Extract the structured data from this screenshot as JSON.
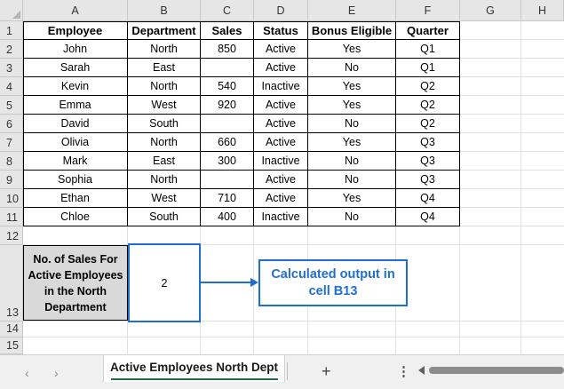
{
  "columns": [
    "A",
    "B",
    "C",
    "D",
    "E",
    "F",
    "G",
    "H"
  ],
  "rows": [
    "1",
    "2",
    "3",
    "4",
    "5",
    "6",
    "7",
    "8",
    "9",
    "10",
    "11",
    "12",
    "13",
    "14",
    "15"
  ],
  "table": {
    "headers": [
      "Employee",
      "Department",
      "Sales",
      "Status",
      "Bonus Eligible",
      "Quarter"
    ],
    "rows": [
      [
        "John",
        "North",
        "850",
        "Active",
        "Yes",
        "Q1"
      ],
      [
        "Sarah",
        "East",
        "",
        "Active",
        "No",
        "Q1"
      ],
      [
        "Kevin",
        "North",
        "540",
        "Inactive",
        "Yes",
        "Q2"
      ],
      [
        "Emma",
        "West",
        "920",
        "Active",
        "Yes",
        "Q2"
      ],
      [
        "David",
        "South",
        "",
        "Active",
        "No",
        "Q2"
      ],
      [
        "Olivia",
        "North",
        "660",
        "Active",
        "Yes",
        "Q3"
      ],
      [
        "Mark",
        "East",
        "300",
        "Inactive",
        "No",
        "Q3"
      ],
      [
        "Sophia",
        "North",
        "",
        "Active",
        "No",
        "Q3"
      ],
      [
        "Ethan",
        "West",
        "710",
        "Active",
        "Yes",
        "Q4"
      ],
      [
        "Chloe",
        "South",
        "400",
        "Inactive",
        "No",
        "Q4"
      ]
    ]
  },
  "summary": {
    "label_lines": [
      "No. of Sales For",
      "Active Employees",
      "in the North",
      "Department"
    ],
    "value": "2"
  },
  "callout": {
    "lines": [
      "Calculated output in",
      "cell B13"
    ]
  },
  "tabbar": {
    "prev_icon": "‹",
    "next_icon": "›",
    "sheet_name": "Active Employees North Dept",
    "add_icon": "+",
    "more_icon": "⋮"
  },
  "colors": {
    "accent_blue": "#1f6fd1",
    "tab_underline": "#1e7145",
    "header_fill": "#d9d9d9"
  }
}
